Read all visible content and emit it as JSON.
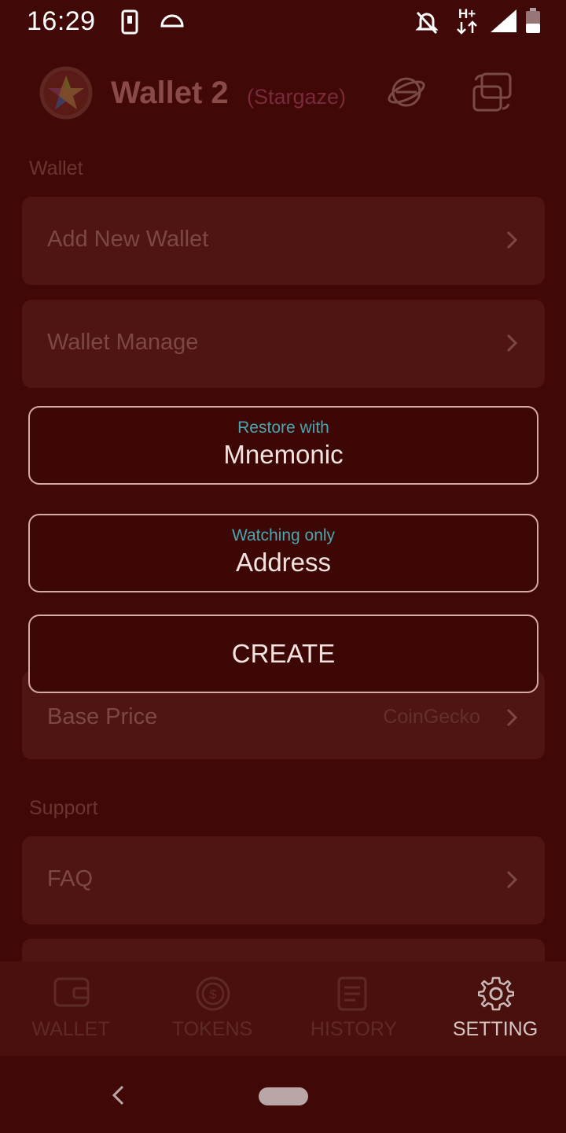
{
  "status_bar": {
    "time": "16:29",
    "network": "H+"
  },
  "header": {
    "wallet_name": "Wallet 2",
    "chain": "(Stargaze)"
  },
  "sections": {
    "wallet": "Wallet",
    "support": "Support"
  },
  "rows": {
    "add_new_wallet": "Add New Wallet",
    "wallet_manage": "Wallet Manage",
    "base_price": {
      "label": "Base Price",
      "value": "CoinGecko"
    },
    "faq": "FAQ"
  },
  "dialog": {
    "restore": {
      "sub": "Restore with",
      "main": "Mnemonic"
    },
    "watch": {
      "sub": "Watching only",
      "main": "Address"
    },
    "create": "CREATE"
  },
  "bottom_nav": [
    {
      "label": "WALLET",
      "icon": "wallet-icon",
      "active": false
    },
    {
      "label": "TOKENS",
      "icon": "tokens-icon",
      "active": false
    },
    {
      "label": "HISTORY",
      "icon": "history-icon",
      "active": false
    },
    {
      "label": "SETTING",
      "icon": "gear-icon",
      "active": true
    }
  ],
  "colors": {
    "background": "#400907",
    "dialog_border": "#d7a9a5",
    "accent_teal": "#4aa6b0"
  }
}
